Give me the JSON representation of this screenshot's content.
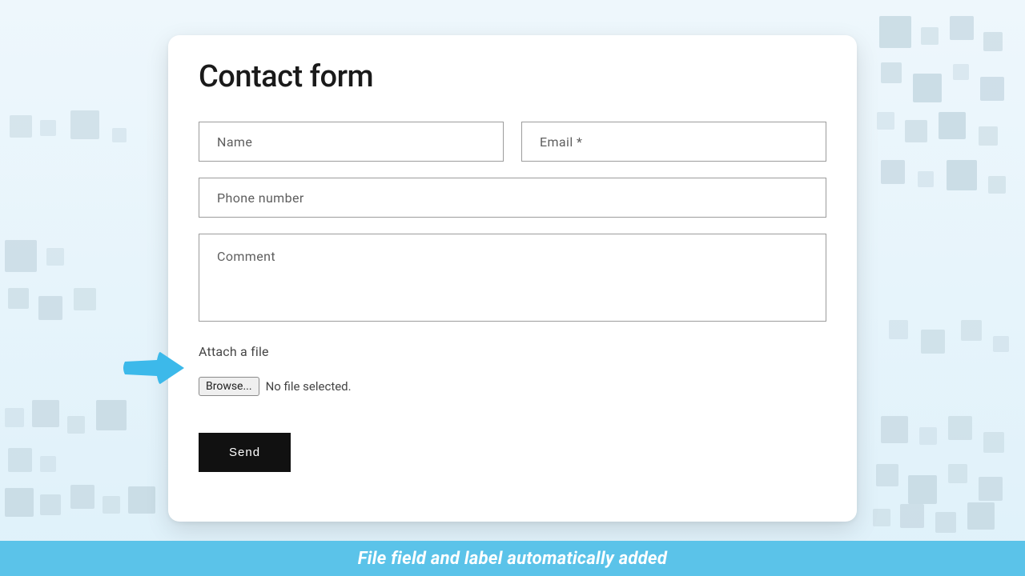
{
  "form": {
    "title": "Contact form",
    "name_placeholder": "Name",
    "email_placeholder": "Email *",
    "phone_placeholder": "Phone number",
    "comment_placeholder": "Comment",
    "attach_label": "Attach a file",
    "browse_label": "Browse...",
    "file_status": "No file selected.",
    "send_label": "Send"
  },
  "caption": "File field and label automatically added",
  "colors": {
    "accent": "#5bc3e9",
    "arrow": "#3cb9ea"
  }
}
